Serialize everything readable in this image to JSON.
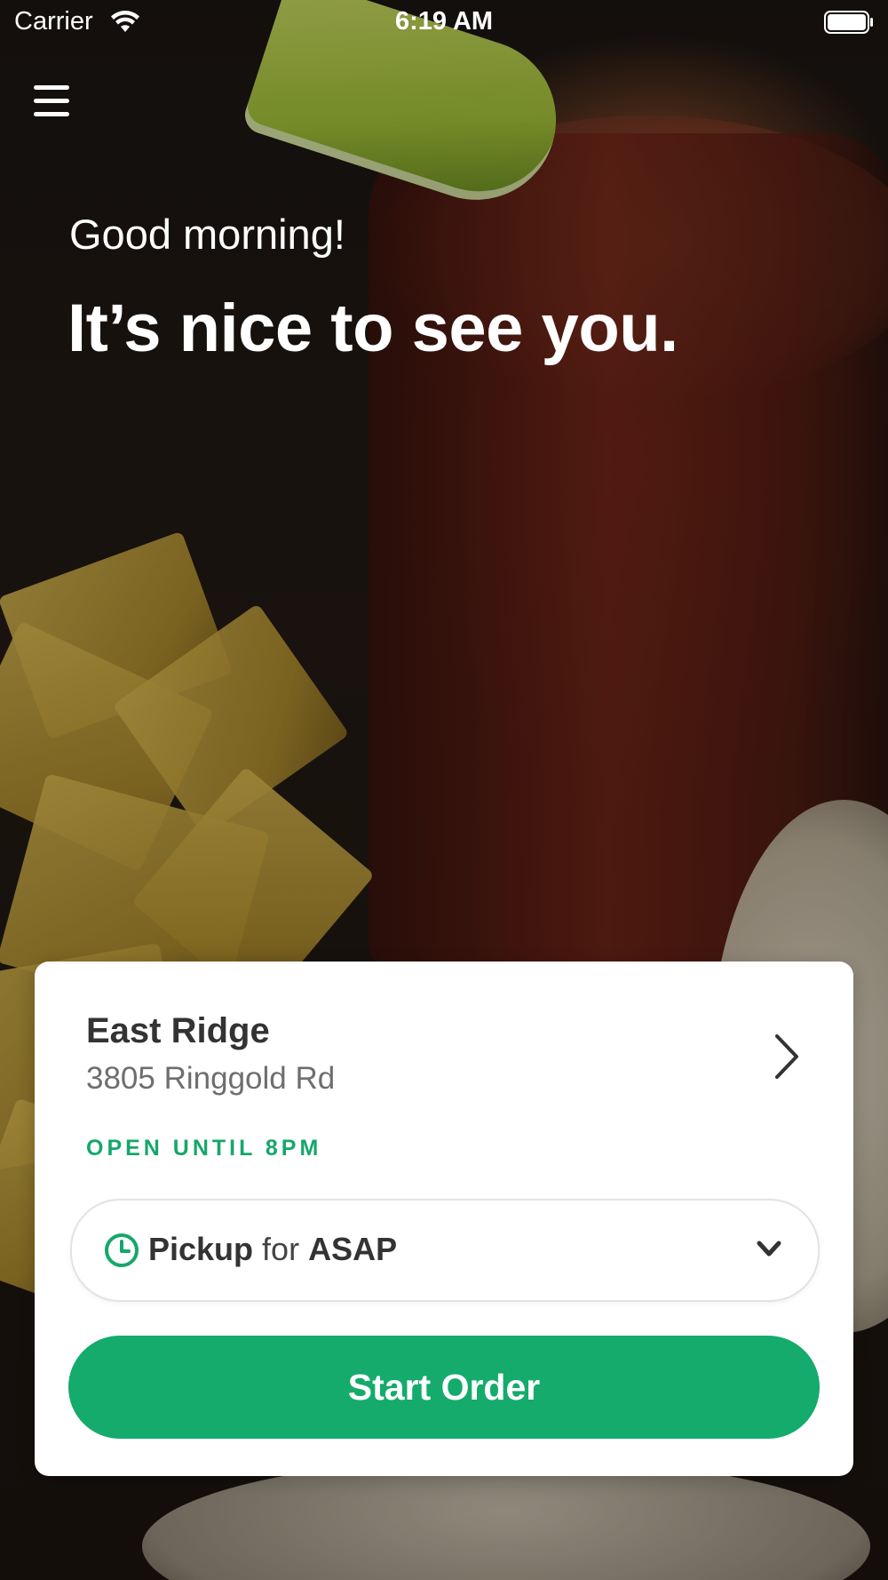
{
  "status_bar": {
    "carrier": "Carrier",
    "time": "6:19 AM",
    "wifi_icon": "wifi-icon",
    "battery_icon": "battery-icon"
  },
  "header": {
    "menu_icon": "menu-icon"
  },
  "greeting": {
    "subtitle": "Good morning!",
    "title": "It’s nice to see you."
  },
  "location_card": {
    "store_name": "East Ridge",
    "address": "3805 Ringgold Rd",
    "open_status": "OPEN UNTIL 8PM",
    "chevron_icon": "chevron-right-icon",
    "order_type": {
      "icon": "clock-icon",
      "mode": "Pickup",
      "connector": "for",
      "time": "ASAP",
      "dropdown_icon": "chevron-down-icon"
    },
    "start_button_label": "Start Order"
  },
  "colors": {
    "accent_green": "#14ab6c",
    "open_status_green": "#16a76a",
    "text_dark": "#333333",
    "text_muted": "#6e6e6e"
  }
}
